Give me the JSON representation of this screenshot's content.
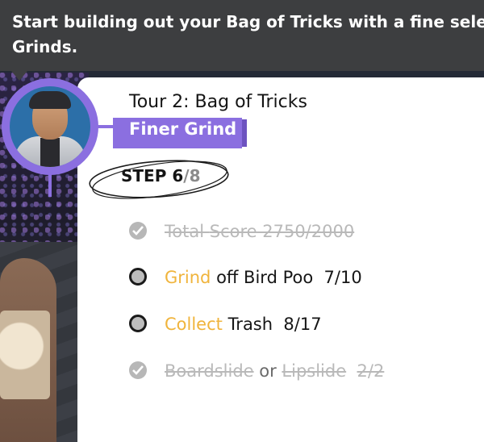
{
  "tooltip": {
    "text": "Start building out your Bag of Tricks with a fine selec Grinds."
  },
  "tour": {
    "title": "Tour 2: Bag of Tricks",
    "challenge": "Finer Grind",
    "step_prefix": "STEP ",
    "step_current": "6",
    "step_total": "/8"
  },
  "objectives": [
    {
      "status": "complete",
      "parts": [
        "Total ",
        "Score",
        " 2750/2000"
      ]
    },
    {
      "status": "open",
      "highlight": "Grind",
      "rest": " off Bird Poo",
      "progress": "7/10"
    },
    {
      "status": "open",
      "highlight": "Collect",
      "rest": " Trash",
      "progress": "8/17"
    },
    {
      "status": "complete",
      "a": "Boardslide",
      "or": " or ",
      "b": "Lipslide",
      "progress": "2/2"
    }
  ],
  "colors": {
    "accent": "#8b6fe0",
    "highlight": "#f0b43c",
    "tooltip_bg": "#3d3e40"
  }
}
